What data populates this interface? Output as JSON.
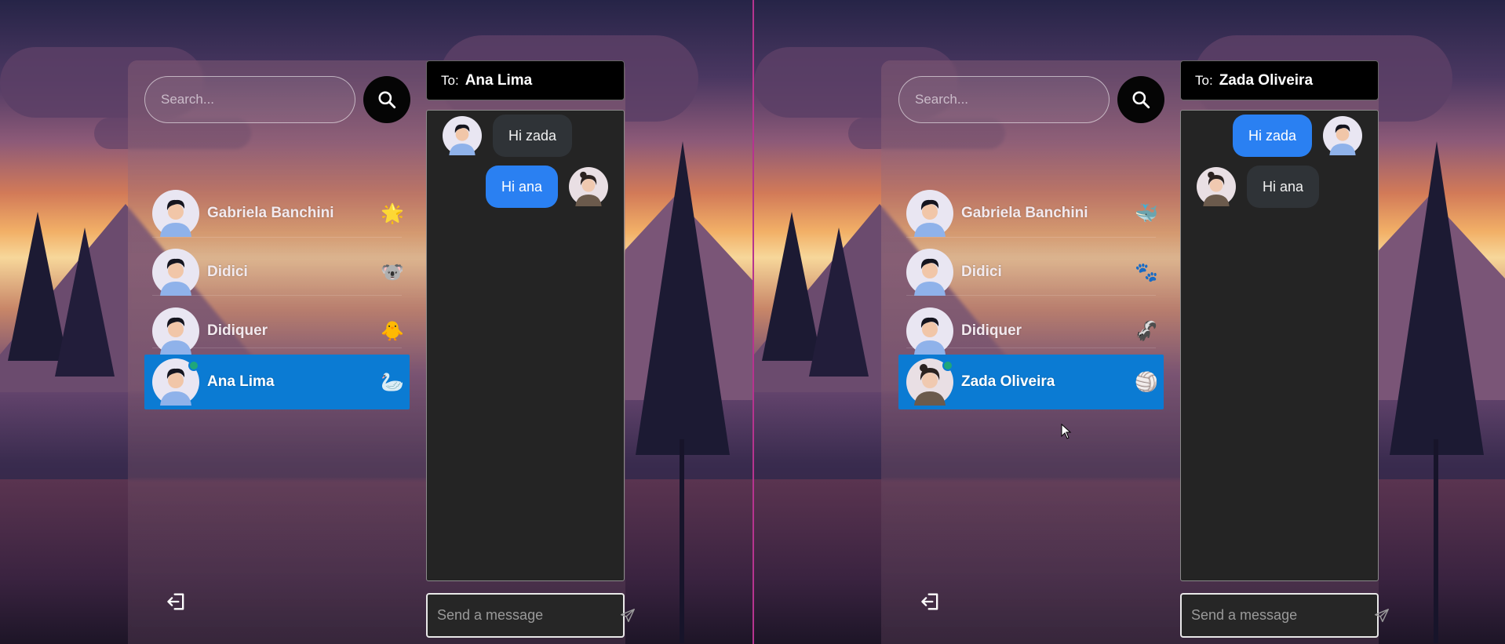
{
  "panes": [
    {
      "search": {
        "placeholder": "Search..."
      },
      "contacts": [
        {
          "name": "Gabriela Banchini",
          "emoji": "🌟",
          "active": false
        },
        {
          "name": "Didici",
          "emoji": "🐨",
          "active": false
        },
        {
          "name": "Didiquer",
          "emoji": "🐥",
          "active": false
        },
        {
          "name": "Ana Lima",
          "emoji": "🦢",
          "active": true
        }
      ],
      "chat": {
        "to_label": "To:",
        "to_name": "Ana Lima",
        "messages": [
          {
            "text": "Hi zada",
            "direction": "in"
          },
          {
            "text": "Hi ana",
            "direction": "out"
          }
        ]
      },
      "composer": {
        "placeholder": "Send a message"
      }
    },
    {
      "search": {
        "placeholder": "Search..."
      },
      "contacts": [
        {
          "name": "Gabriela Banchini",
          "emoji": "🐳",
          "active": false
        },
        {
          "name": "Didici",
          "emoji": "🐾",
          "active": false
        },
        {
          "name": "Didiquer",
          "emoji": "🦨",
          "active": false
        },
        {
          "name": "Zada Oliveira",
          "emoji": "🏐",
          "active": true
        }
      ],
      "chat": {
        "to_label": "To:",
        "to_name": "Zada Oliveira",
        "messages": [
          {
            "text": "Hi zada",
            "direction": "out"
          },
          {
            "text": "Hi ana",
            "direction": "in"
          }
        ]
      },
      "composer": {
        "placeholder": "Send a message"
      }
    }
  ],
  "colors": {
    "active_contact": "#0b7bd3",
    "outgoing_bubble": "#2a80f2",
    "incoming_bubble": "#2f3337",
    "online_dot": "#1fa77a",
    "pane_divider": "#b6348f"
  },
  "icons": [
    "search-icon",
    "logout-icon",
    "send-icon",
    "mouse-cursor-icon"
  ]
}
